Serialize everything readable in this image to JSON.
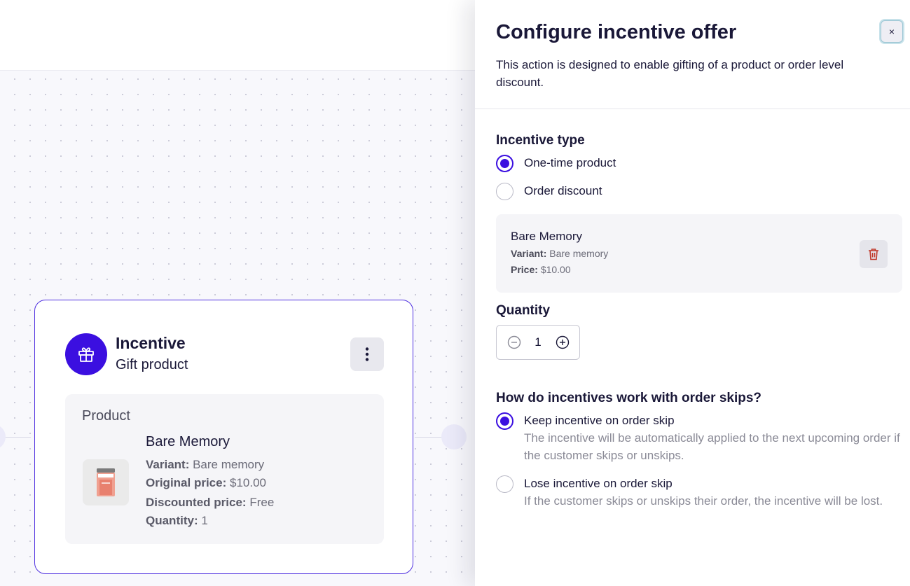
{
  "node": {
    "title": "Incentive",
    "subtitle": "Gift product",
    "icon": "gift-icon",
    "accent": "#3b0fe0",
    "product": {
      "heading": "Product",
      "name": "Bare Memory",
      "variant_label": "Variant:",
      "variant": "Bare memory",
      "original_price_label": "Original price:",
      "original_price": "$10.00",
      "discounted_price_label": "Discounted price:",
      "discounted_price": "Free",
      "quantity_label": "Quantity:",
      "quantity": "1"
    }
  },
  "panel": {
    "title": "Configure incentive offer",
    "description": "This action is designed to enable gifting of a product or order level discount.",
    "close_label": "×",
    "incentive_type": {
      "label": "Incentive type",
      "options": [
        {
          "label": "One-time product",
          "selected": true
        },
        {
          "label": "Order discount",
          "selected": false
        }
      ]
    },
    "item": {
      "name": "Bare Memory",
      "variant_label": "Variant:",
      "variant": "Bare memory",
      "price_label": "Price:",
      "price": "$10.00"
    },
    "quantity": {
      "label": "Quantity",
      "value": "1"
    },
    "skips": {
      "label": "How do incentives work with order skips?",
      "options": [
        {
          "label": "Keep incentive on order skip",
          "help": "The incentive will be automatically applied to the next upcoming order if the customer skips or unskips.",
          "selected": true
        },
        {
          "label": "Lose incentive on order skip",
          "help": "If the customer skips or unskips their order, the incentive will be lost.",
          "selected": false
        }
      ]
    }
  }
}
